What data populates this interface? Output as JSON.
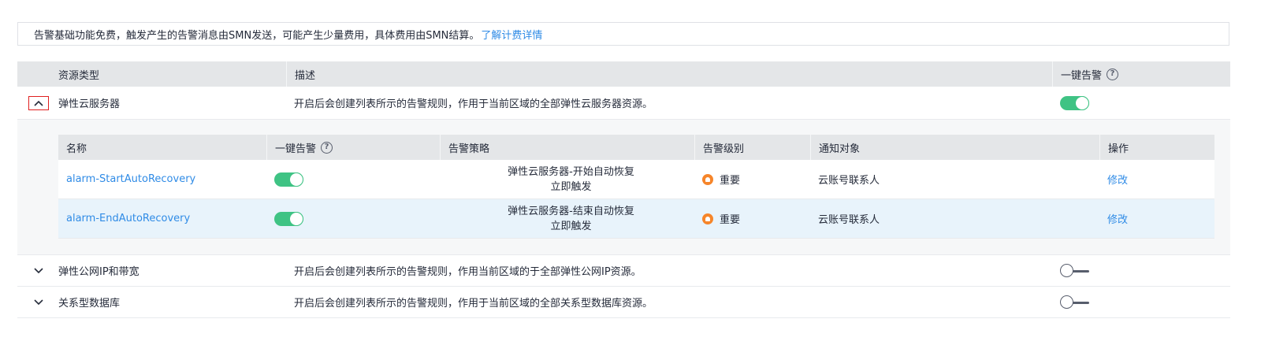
{
  "notice": {
    "text": "告警基础功能免费，触发产生的告警消息由SMN发送，可能产生少量费用，具体费用由SMN结算。",
    "link": "了解计费详情"
  },
  "table": {
    "headers": {
      "type": "资源类型",
      "desc": "描述",
      "switch": "一键告警"
    },
    "groups": [
      {
        "name": "弹性云服务器",
        "desc": "开启后会创建列表所示的告警规则，作用于当前区域的全部弹性云服务器资源。",
        "enabled": true,
        "expanded": true
      },
      {
        "name": "弹性公网IP和带宽",
        "desc": "开启后会创建列表所示的告警规则，作用当前区域的于全部弹性公网IP资源。",
        "enabled": false,
        "expanded": false
      },
      {
        "name": "关系型数据库",
        "desc": "开启后会创建列表所示的告警规则，作用于当前区域的全部关系型数据库资源。",
        "enabled": false,
        "expanded": false
      }
    ]
  },
  "subtable": {
    "headers": {
      "name": "名称",
      "switch": "一键告警",
      "policy": "告警策略",
      "severity": "告警级别",
      "notify": "通知对象",
      "action": "操作"
    },
    "rows": [
      {
        "name": "alarm-StartAutoRecovery",
        "enabled": true,
        "policy_line1": "弹性云服务器-开始自动恢复",
        "policy_line2": "立即触发",
        "severity": "重要",
        "notify": "云账号联系人",
        "action": "修改"
      },
      {
        "name": "alarm-EndAutoRecovery",
        "enabled": true,
        "policy_line1": "弹性云服务器-结束自动恢复",
        "policy_line2": "立即触发",
        "severity": "重要",
        "notify": "云账号联系人",
        "action": "修改"
      }
    ]
  },
  "colors": {
    "accent": "#2f8be6",
    "toggle_on": "#3fc384",
    "severity_important": "#f6852a"
  },
  "icons": {
    "help": "question-circle-icon",
    "collapse": "chevron-up-icon",
    "expand": "chevron-down-icon",
    "severity": "bell-icon"
  }
}
